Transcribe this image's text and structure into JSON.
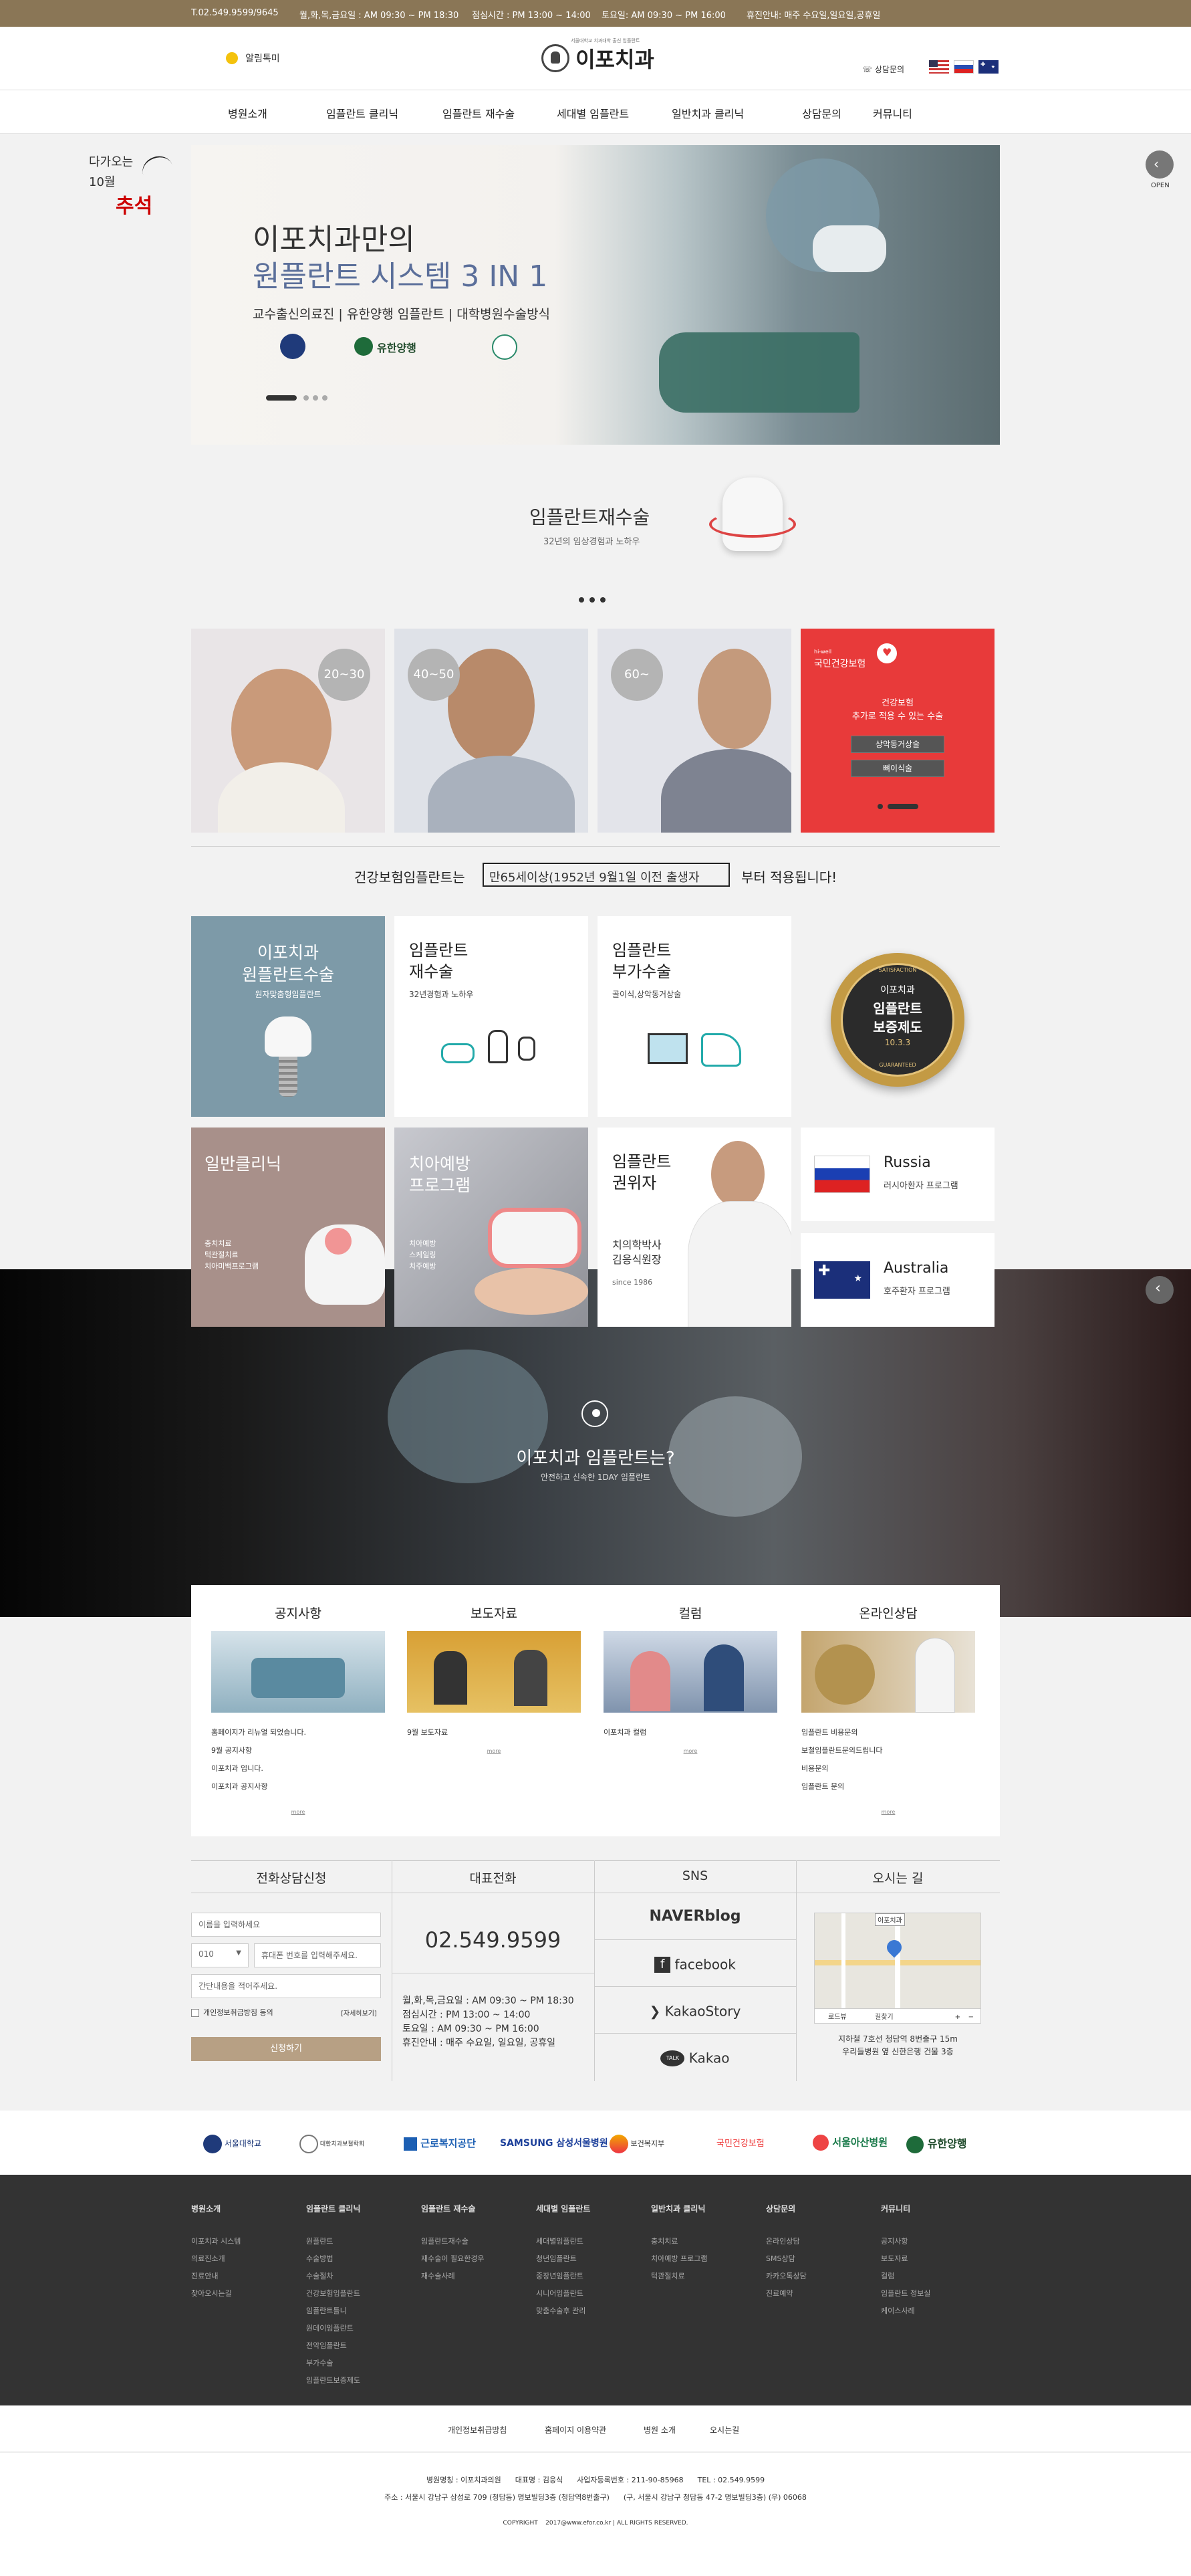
{
  "topbar": {
    "phone": "T.02.549.9599/9645",
    "weekday": "월,화,목,금요일 : AM 09:30 ~ PM 18:30",
    "lunch": "점심시간 : PM 13:00 ~ 14:00",
    "saturday": "토요일: AM 09:30 ~ PM 16:00",
    "holiday": "휴진안내: 매주 수요일,일요일,공휴일"
  },
  "header": {
    "alarm_label": "알림톡미",
    "logo_text": "이포치과",
    "logo_small": "서울대학교 치과대학 출신 임플란트",
    "consult_label": "상담문의"
  },
  "nav": [
    "병원소개",
    "임플란트 클리닉",
    "임플란트 재수술",
    "세대별 임플란트",
    "일반치과 클리닉",
    "상담문의",
    "커뮤니티"
  ],
  "side_badge": {
    "line1": "다가오는",
    "line2": "10월",
    "line3": "추석"
  },
  "hero": {
    "title1": "이포치과만의",
    "title2": "원플란트 시스템 3 IN 1",
    "subtitle": "교수출신의료진 | 유한양행 임플란트 | 대학병원수술방식",
    "logo_label": "유한양행"
  },
  "open_label": "OPEN",
  "reimplant": {
    "title": "임플란트재수술",
    "sub": "32년의 임상경험과 노하우"
  },
  "age_cards": [
    "20~30",
    "40~50",
    "60~"
  ],
  "insurance_card": {
    "brand_top": "hi-well",
    "brand": "국민건강보험",
    "line1": "건강보험",
    "line2": "추가로 적용 수 있는 수술",
    "btn1": "상악동거상술",
    "btn2": "뼈이식술"
  },
  "notice_bar": {
    "pre": "건강보험임플란트는",
    "box": "만65세이상(1952년 9월1일 이전 출생자",
    "post": "부터 적용됩니다!"
  },
  "grid": {
    "c1_title1": "이포치과",
    "c1_title2": "원플란트수술",
    "c1_sub": "원자맞춤형임플란트",
    "c2_title1": "임플란트",
    "c2_title2": "재수술",
    "c2_sub": "32년경험과 노하우",
    "c3_title1": "임플란트",
    "c3_title2": "부가수술",
    "c3_sub": "골이식,상악동거상술",
    "badge_top": "SATISFACTION",
    "badge_t1": "이포치과",
    "badge_t2": "임플란트",
    "badge_t3": "보증제도",
    "badge_t4": "10.3.3",
    "badge_bottom": "GUARANTEED",
    "c5_title": "일반클리닉",
    "c5_l1": "충치치료",
    "c5_l2": "턱관절치료",
    "c5_l3": "치아미백프로그램",
    "c6_title1": "치아예방",
    "c6_title2": "프로그램",
    "c6_l1": "치아예방",
    "c6_l2": "스케일링",
    "c6_l3": "치주예방",
    "c7_title1": "임플란트",
    "c7_title2": "권위자",
    "c7_l1": "치의학박사",
    "c7_l2": "김응식원장",
    "c7_since": "since 1986",
    "russia": "Russia",
    "russia_sub": "러시아환자 프로그램",
    "australia": "Australia",
    "australia_sub": "호주환자 프로그램"
  },
  "video": {
    "title": "이포치과 임플란트는?",
    "sub": "안전하고 신속한 1DAY 임플란트"
  },
  "boards": [
    {
      "title": "공지사항",
      "items": [
        "홈페이지가 리뉴얼 되었습니다.",
        "9월 공지사항",
        "이포치과 입니다.",
        "이포치과 공지사항"
      ],
      "more": "more"
    },
    {
      "title": "보도자료",
      "items": [
        "9월 보도자료"
      ],
      "more": "more"
    },
    {
      "title": "컬럼",
      "items": [
        "이포치과 컬럼"
      ],
      "more": "more"
    },
    {
      "title": "온라인상담",
      "items": [
        "임플란트 비용문의",
        "보철임플란트문의드립니다",
        "비용문의",
        "임플란트 문의"
      ],
      "more": "more"
    }
  ],
  "consult": {
    "title": "전화상담신청",
    "name_ph": "이름을 입력하세요",
    "phone_prefix": "010",
    "phone_ph": "휴대폰 번호를 입력해주세요.",
    "msg_ph": "간단내용을 적어주세요.",
    "agree": "개인정보취급방침 동의",
    "detail": "[자세히보기]",
    "submit": "신청하기"
  },
  "rep_phone": {
    "title": "대표전화",
    "number": "02.549.9599",
    "h1": "월,화,목,금요일 : AM 09:30 ~ PM 18:30",
    "h2": "점심시간 : PM 13:00 ~ 14:00",
    "h3": "토요일 : AM 09:30 ~ PM 16:00",
    "h4": "휴진안내 : 매주 수요일, 일요일, 공휴일"
  },
  "sns": {
    "title": "SNS",
    "items": [
      "NAVERblog",
      "facebook",
      "KakaoStory",
      "Kakao"
    ]
  },
  "map": {
    "title": "오시는 길",
    "label1": "이포치과",
    "l1": "지하철 7호선 청담역 8번출구 15m",
    "l2": "우리들병원 옆 신한은행 건물 3층",
    "road": "로드뷰",
    "dir": "길찾기"
  },
  "partners": [
    "서울대학교",
    "대한치과보철학회",
    "근로복지공단",
    "SAMSUNG 삼성서울병원",
    "보건복지부",
    "국민건강보험",
    "서울아산병원",
    "유한양행"
  ],
  "footer_cols": [
    {
      "title": "병원소개",
      "items": [
        "이포치과 시스템",
        "의료진소개",
        "진료안내",
        "찾아오시는길"
      ]
    },
    {
      "title": "임플란트 클리닉",
      "items": [
        "원플란트",
        "수술방법",
        "수술절차",
        "건강보험임플란트",
        "임플란트틀니",
        "원데이임플란트",
        "전악임플란트",
        "부가수술",
        "임플란트보증제도"
      ]
    },
    {
      "title": "임플란트 재수술",
      "items": [
        "임플란트재수술",
        "재수술이 필요한경우",
        "재수술사례"
      ]
    },
    {
      "title": "세대별 임플란트",
      "items": [
        "세대별임플란트",
        "청년임플란트",
        "중장년임플란트",
        "시니어임플란트",
        "맞춤수술후 관리"
      ]
    },
    {
      "title": "일반치과 클리닉",
      "items": [
        "충치치료",
        "치아예방 프로그램",
        "턱관절치료"
      ]
    },
    {
      "title": "상담문의",
      "items": [
        "온라인상담",
        "SMS상담",
        "카카오톡상담",
        "진료예약"
      ]
    },
    {
      "title": "커뮤니티",
      "items": [
        "공지사항",
        "보도자료",
        "컬럼",
        "임플란트 정보실",
        "케이스사례"
      ]
    }
  ],
  "footer_links": [
    "개인정보취급방침",
    "홈페이지 이용약관",
    "병원 소개",
    "오시는길"
  ],
  "footer_info": {
    "line1": "병원명칭 : 이포치과의원      대표명 : 김응식      사업자등록번호 : 211-90-85968      TEL : 02.549.9599",
    "line2": "주소 : 서울시 강남구 삼성로 709 (청담동) 명보빌딩3층 (청담역8번출구)      (구, 서울시 강남구 청담동 47-2 명보빌딩3층) (우) 06068",
    "copyright": "COPYRIGHT    2017@www.efor.co.kr | ALL RIGHTS RESERVED."
  },
  "colors": {
    "gold": "#8a7656",
    "red": "#e83a3a",
    "teal": "#7d9aa8",
    "brown": "#a8908a"
  }
}
